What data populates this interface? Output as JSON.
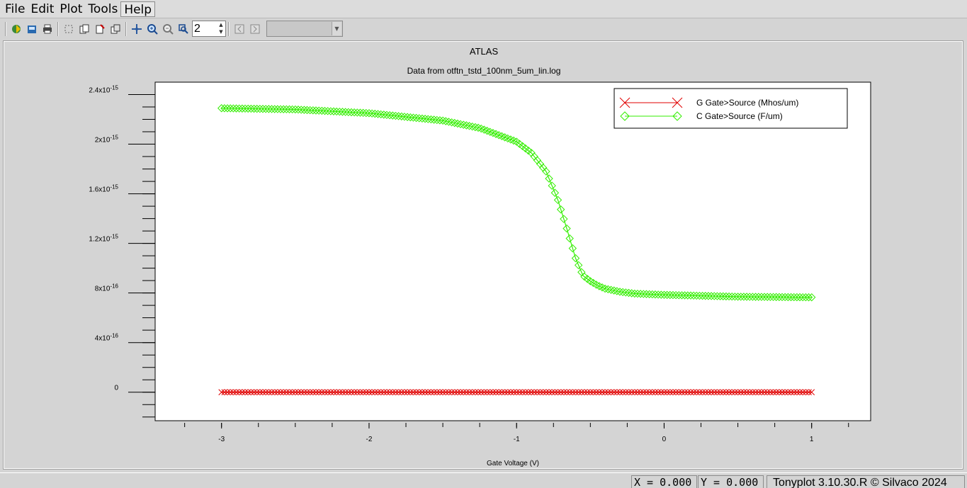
{
  "menubar": {
    "items": [
      {
        "label": "File"
      },
      {
        "label": "Edit"
      },
      {
        "label": "Plot"
      },
      {
        "label": "Tools"
      },
      {
        "label": "Help"
      }
    ]
  },
  "toolbar": {
    "page_number": "2",
    "plot_select_value": ""
  },
  "status": {
    "x_readout": "X = 0.000",
    "y_readout": "Y = 0.000",
    "version": "Tonyplot 3.10.30.R © Silvaco 2024"
  },
  "colors": {
    "g_series": "#e00000",
    "c_series": "#33ee00",
    "plot_bg": "#ffffff",
    "frame_bg": "#d4d4d4"
  },
  "chart_data": {
    "type": "line",
    "title": "ATLAS",
    "subtitle": "Data from otftn_tstd_100nm_5um_lin.log",
    "xlabel": "Gate Voltage (V)",
    "ylabel": "",
    "xlim": [
      -3.45,
      1.4
    ],
    "ylim": [
      -2.3e-16,
      2.5e-15
    ],
    "x_ticks": [
      {
        "value": -3,
        "label": "-3"
      },
      {
        "value": -2,
        "label": "-2"
      },
      {
        "value": -1,
        "label": "-1"
      },
      {
        "value": 0,
        "label": "0"
      },
      {
        "value": 1,
        "label": "1"
      }
    ],
    "y_ticks": [
      {
        "value": 2.4e-15,
        "mant": "2.4x10",
        "exp": "-15"
      },
      {
        "value": 2e-15,
        "mant": "2x10",
        "exp": "-15"
      },
      {
        "value": 1.6e-15,
        "mant": "1.6x10",
        "exp": "-15"
      },
      {
        "value": 1.2e-15,
        "mant": "1.2x10",
        "exp": "-15"
      },
      {
        "value": 8e-16,
        "mant": "8x10",
        "exp": "-16"
      },
      {
        "value": 4e-16,
        "mant": "4x10",
        "exp": "-16"
      },
      {
        "value": 0,
        "mant": "0",
        "exp": ""
      }
    ],
    "legend": "top-right",
    "series": [
      {
        "name": "G Gate>Source (Mhos/um)",
        "marker": "x",
        "x": [
          -3,
          -2.5,
          -2,
          -1.5,
          -1,
          -0.5,
          0,
          0.5,
          1
        ],
        "y": [
          0,
          0,
          0,
          0,
          0,
          0,
          0,
          0,
          0
        ]
      },
      {
        "name": "C Gate>Source (F/um)",
        "marker": "diamond",
        "x": [
          -3,
          -2.5,
          -2,
          -1.5,
          -1.25,
          -1.0,
          -0.9,
          -0.8,
          -0.72,
          -0.66,
          -0.6,
          -0.55,
          -0.5,
          -0.45,
          -0.4,
          -0.3,
          -0.2,
          0,
          0.5,
          1
        ],
        "y": [
          2.29e-15,
          2.28e-15,
          2.25e-15,
          2.19e-15,
          2.13e-15,
          2.02e-15,
          1.93e-15,
          1.78e-15,
          1.55e-15,
          1.32e-15,
          1.08e-15,
          9.4e-16,
          8.95e-16,
          8.6e-16,
          8.35e-16,
          8.1e-16,
          7.95e-16,
          7.85e-16,
          7.7e-16,
          7.65e-16
        ]
      }
    ]
  }
}
